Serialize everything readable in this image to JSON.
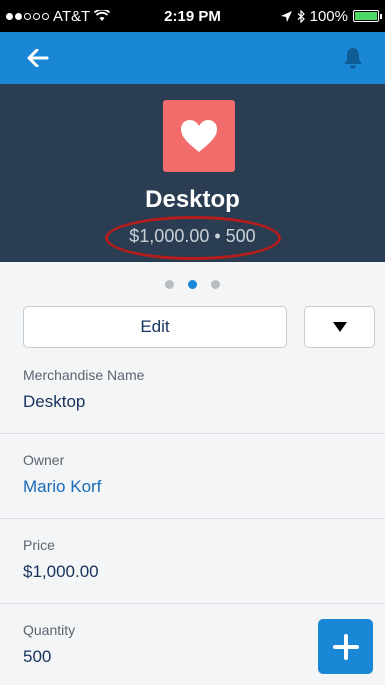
{
  "status_bar": {
    "carrier": "AT&T",
    "time": "2:19 PM",
    "battery": "100%",
    "battery_level": 1.0
  },
  "nav": {
    "back_icon": "back-arrow-icon",
    "notification_icon": "bell-icon"
  },
  "record": {
    "icon": "heart-icon",
    "icon_color": "#f26c6c",
    "title": "Desktop",
    "subtitle": "$1,000.00 • 500"
  },
  "pager": {
    "count": 3,
    "active_index": 1
  },
  "actions": {
    "edit_label": "Edit",
    "more_icon": "triangle-down-icon"
  },
  "fields": [
    {
      "label": "Merchandise Name",
      "value": "Desktop"
    },
    {
      "label": "Owner",
      "value": "Mario Korf"
    },
    {
      "label": "Price",
      "value": "$1,000.00"
    },
    {
      "label": "Quantity",
      "value": "500"
    }
  ],
  "colors": {
    "brand_blue": "#1a87d6",
    "header_dark": "#2b3d52",
    "highlight_red": "#b51d1d"
  }
}
